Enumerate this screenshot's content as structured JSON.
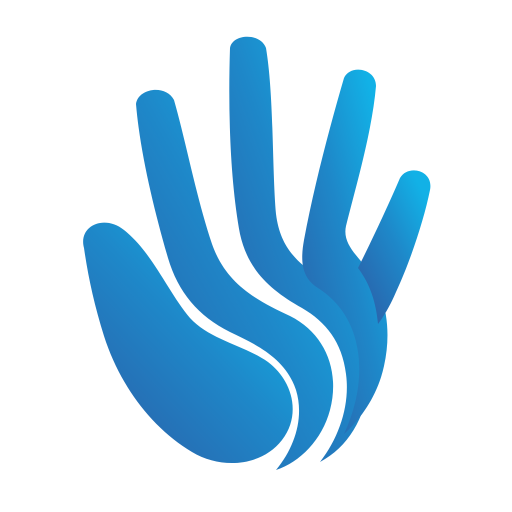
{
  "logo": {
    "icon": "hand-icon",
    "colors": {
      "dark": "#2a63ab",
      "mid": "#1e88c9",
      "light": "#12b1e6",
      "background": "#ffffff"
    }
  }
}
